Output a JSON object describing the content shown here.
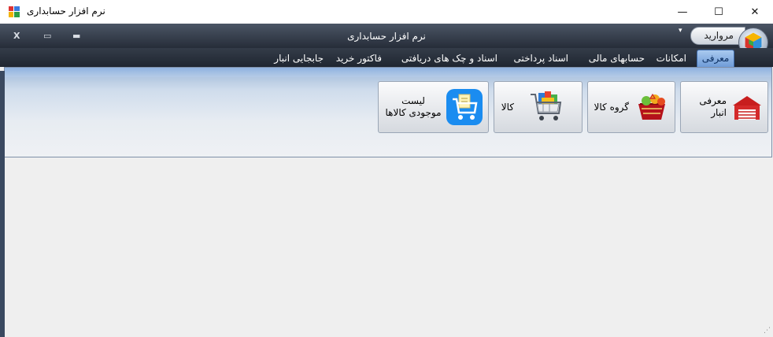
{
  "window": {
    "title": "نرم افزار حسابداری",
    "min_glyph": "—",
    "max_glyph": "☐",
    "close_glyph": "✕"
  },
  "ribbon": {
    "title": "نرم افزار حسابداری",
    "dropdown_glyph": "▾",
    "quick_button": "مروارید",
    "caption_close": "X",
    "caption_restore": "▭",
    "caption_min": "▬"
  },
  "tabs": [
    {
      "label": "معرفی",
      "active": true
    },
    {
      "label": "امکانات"
    },
    {
      "label": "حسابهای مالی"
    },
    {
      "label": "اسناد پرداختی"
    },
    {
      "label": "اسناد و چک های دریافتی"
    },
    {
      "label": "فاکتور خرید"
    },
    {
      "label": "جابجایی انبار"
    }
  ],
  "buttons": [
    {
      "label": "معرفی انبار",
      "icon": "warehouse-icon"
    },
    {
      "label": "گروه کالا",
      "icon": "basket-icon"
    },
    {
      "label": "کالا",
      "icon": "shopping-cart-icon"
    },
    {
      "label": "لیست موجودی کالاها",
      "icon": "cart-list-icon"
    }
  ],
  "colors": {
    "accent": "#6f9cd8",
    "ribbon_dark": "#262d39",
    "panel": "#cfdcec"
  }
}
